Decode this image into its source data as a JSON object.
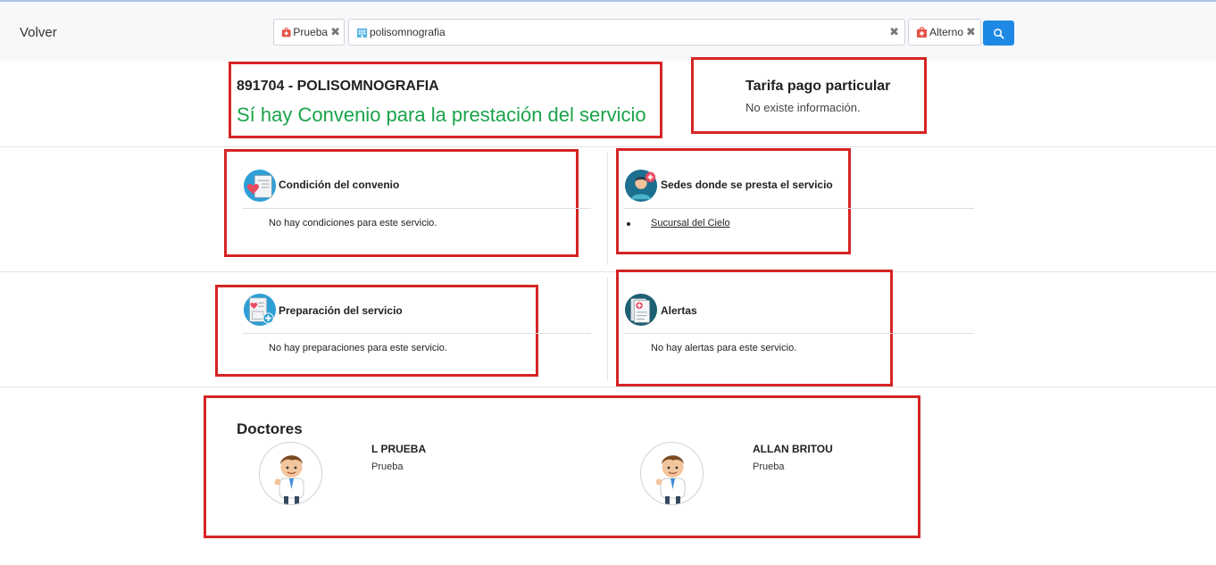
{
  "header": {
    "back_label": "Volver",
    "chips": [
      {
        "label": "Prueba"
      },
      {
        "label": "Alterno"
      }
    ],
    "search": {
      "value": "polisomnografia"
    }
  },
  "service": {
    "code_title": "891704 - POLISOMNOGRAFIA",
    "convenio_text": "Sí hay Convenio para la prestación del servicio"
  },
  "tarifa": {
    "title": "Tarifa pago particular",
    "text": "No existe información."
  },
  "cards": {
    "condicion": {
      "title": "Condición del convenio",
      "text": "No hay condiciones para este servicio."
    },
    "sedes": {
      "title": "Sedes donde se presta el servicio",
      "items": [
        "Sucursal del Cielo"
      ]
    },
    "preparacion": {
      "title": "Preparación del servicio",
      "text": "No hay preparaciones para este servicio."
    },
    "alertas": {
      "title": "Alertas",
      "text": "No hay alertas para este servicio."
    }
  },
  "doctores": {
    "title": "Doctores",
    "list": [
      {
        "name": "L PRUEBA",
        "subtitle": "Prueba"
      },
      {
        "name": "ALLAN BRITOU",
        "subtitle": "Prueba"
      }
    ]
  },
  "colors": {
    "accent_blue": "#1e88e5",
    "convenio_green": "#1aa34a",
    "highlight_red": "#d62424"
  }
}
